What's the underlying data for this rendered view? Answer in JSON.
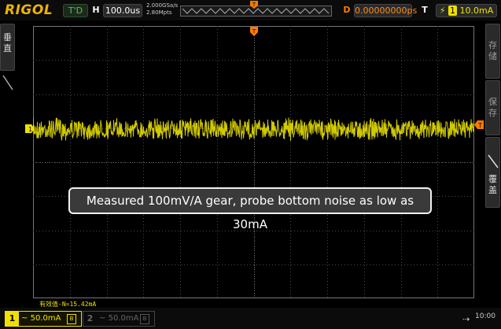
{
  "header": {
    "logo": "RIGOL",
    "run_state": "T'D",
    "horizontal_label": "H",
    "timebase": "100.0us",
    "sample_rate": "2.000GSa/s",
    "memory_depth": "2.80Mpts",
    "delay_label": "D",
    "delay_value": "0.00000000ps",
    "trigger_label": "T",
    "trigger_source_badge": "1",
    "trigger_level": "10.0mA",
    "trigger_icon": "rising-edge-icon",
    "trigger_position_marker": "T"
  },
  "left_menu": {
    "label_1": "垂",
    "label_2": "直"
  },
  "right_menu": {
    "storage_1": "存",
    "storage_2": "储",
    "save_1": "保",
    "save_2": "存",
    "overwrite_1": "覆",
    "overwrite_2": "盖"
  },
  "markers": {
    "ch1_ground": "1",
    "trigger_level": "T"
  },
  "caption": "Measured 100mV/A gear, probe bottom noise as low as 30mA",
  "measurement": "有效值-N=15.42mA",
  "bottom": {
    "ch1_number": "1",
    "ch1_coupling": "~",
    "ch1_scale": "50.0mA",
    "ch1_unit_badge": "B",
    "ch2_number": "2",
    "ch2_coupling": "~",
    "ch2_scale": "50.0mA",
    "ch2_unit_badge": "B",
    "usb_icon": "usb-icon",
    "time": "10:00"
  },
  "colors": {
    "ch1": "#f0e000",
    "trigger": "#ff7a00",
    "grid": "#555555",
    "background": "#000000"
  }
}
